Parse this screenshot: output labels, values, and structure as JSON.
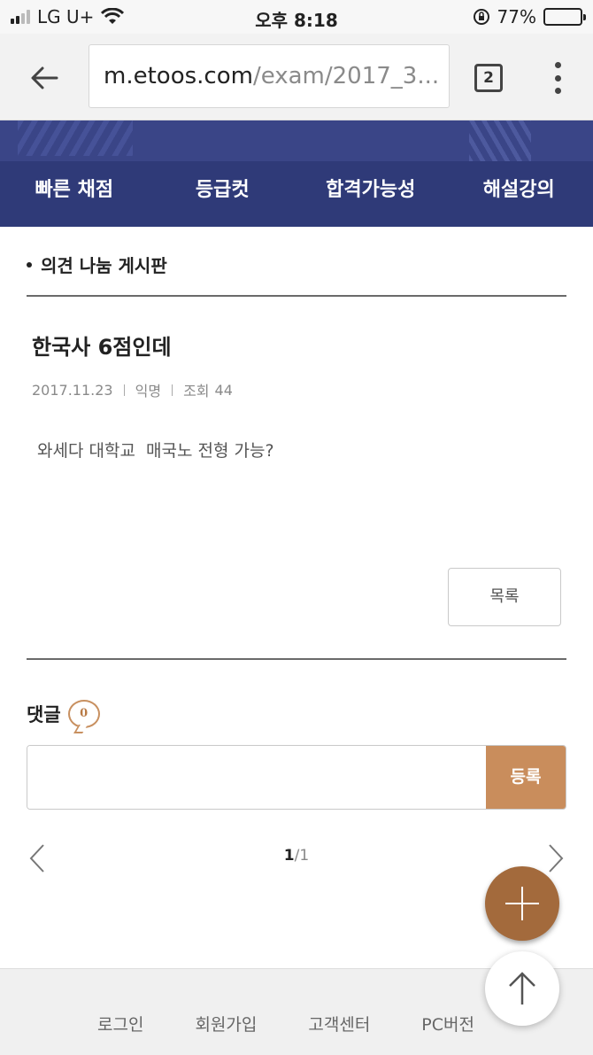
{
  "status_bar": {
    "carrier": "LG U+",
    "time": "오후 8:18",
    "battery_percent": "77%",
    "battery_level": 0.77
  },
  "browser": {
    "url_host": "m.etoos.com",
    "url_path": "/exam/2017_3...",
    "tab_count": "2"
  },
  "nav": {
    "items": [
      "빠른 채점",
      "등급컷",
      "합격가능성",
      "해설강의"
    ]
  },
  "board": {
    "title": "의견 나눔 게시판"
  },
  "post": {
    "title": "한국사 6점인데",
    "date": "2017.11.23",
    "author": "익명",
    "views_label": "조회",
    "views": "44",
    "body": "와세다 대학교  매국노 전형 가능?",
    "list_button": "목록"
  },
  "comments": {
    "label": "댓글",
    "count": "0",
    "input_placeholder": "",
    "submit_label": "등록"
  },
  "pager": {
    "current": "1",
    "total": "/1"
  },
  "footer": {
    "links": [
      "로그인",
      "회원가입",
      "고객센터",
      "PC버전"
    ]
  },
  "colors": {
    "nav_bg": "#2f3a78",
    "accent": "#c98d5c",
    "fab": "#a36a3c"
  }
}
